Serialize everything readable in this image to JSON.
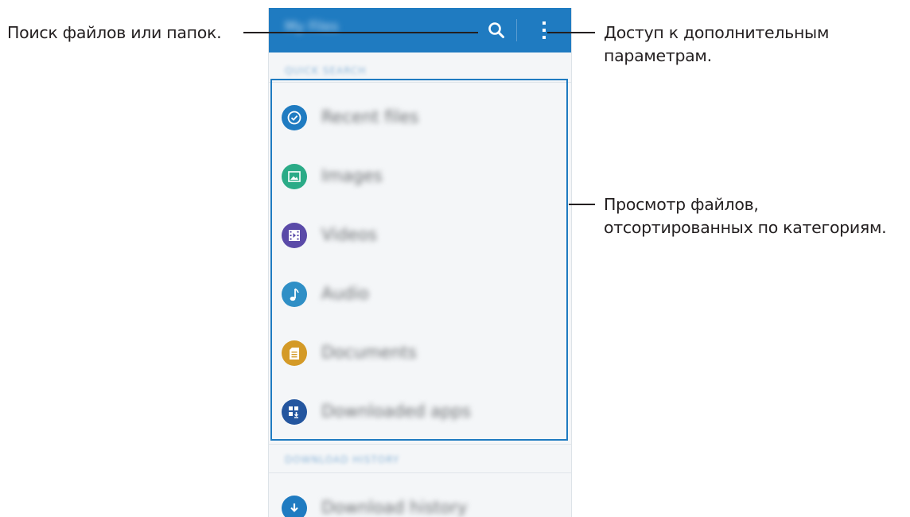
{
  "annotations": {
    "search": "Поиск файлов или папок.",
    "more_options": "Доступ к дополнительным\nпараметрам.",
    "categories": "Просмотр файлов,\nотсортированных по категориям."
  },
  "app": {
    "title": "My Files",
    "search_icon": "search-icon",
    "more_icon": "more-vertical-icon",
    "accent_color": "#1f7bc1"
  },
  "sections": {
    "quick_search": "QUICK SEARCH",
    "download_history": "DOWNLOAD HISTORY"
  },
  "categories": [
    {
      "label": "Recent files",
      "icon": "clock-icon",
      "color": "#1f7bc1"
    },
    {
      "label": "Images",
      "icon": "image-icon",
      "color": "#2bab87"
    },
    {
      "label": "Videos",
      "icon": "video-icon",
      "color": "#5a4aa8"
    },
    {
      "label": "Audio",
      "icon": "music-note-icon",
      "color": "#2f8fc6"
    },
    {
      "label": "Documents",
      "icon": "document-icon",
      "color": "#d49a27"
    },
    {
      "label": "Downloaded apps",
      "icon": "apps-download-icon",
      "color": "#24569f"
    }
  ],
  "history": [
    {
      "label": "Download history",
      "icon": "download-icon",
      "color": "#1f7bc1"
    }
  ]
}
